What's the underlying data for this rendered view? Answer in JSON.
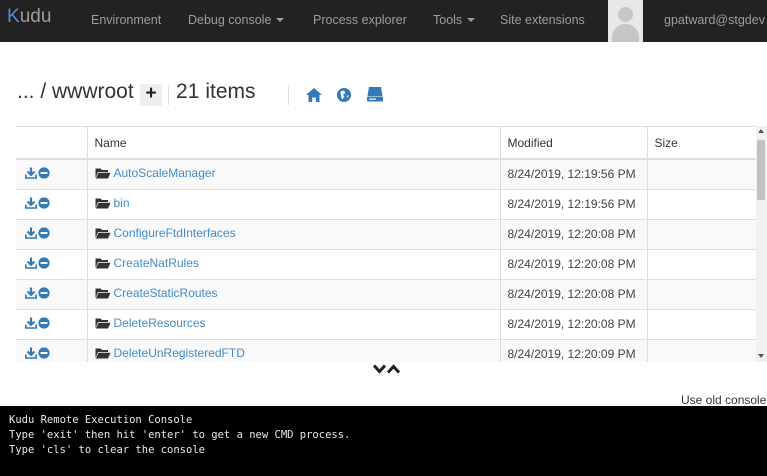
{
  "nav": {
    "brand": "Kudu",
    "items": [
      {
        "label": "Environment",
        "dropdown": false
      },
      {
        "label": "Debug console",
        "dropdown": true
      },
      {
        "label": "Process explorer",
        "dropdown": false
      },
      {
        "label": "Tools",
        "dropdown": true
      },
      {
        "label": "Site extensions",
        "dropdown": false
      }
    ],
    "user": "gpatward@stgdev"
  },
  "breadcrumb": {
    "path": "... / wwwroot",
    "add_label": "+",
    "count": "21",
    "count_label": "items",
    "icons": [
      "home-icon",
      "globe-icon",
      "drive-icon"
    ]
  },
  "table": {
    "columns": [
      "",
      "Name",
      "Modified",
      "Size"
    ],
    "rows": [
      {
        "name": "AutoScaleManager",
        "modified": "8/24/2019, 12:19:56 PM",
        "size": ""
      },
      {
        "name": "bin",
        "modified": "8/24/2019, 12:19:56 PM",
        "size": ""
      },
      {
        "name": "ConfigureFtdInterfaces",
        "modified": "8/24/2019, 12:20:08 PM",
        "size": ""
      },
      {
        "name": "CreateNatRules",
        "modified": "8/24/2019, 12:20:08 PM",
        "size": ""
      },
      {
        "name": "CreateStaticRoutes",
        "modified": "8/24/2019, 12:20:08 PM",
        "size": ""
      },
      {
        "name": "DeleteResources",
        "modified": "8/24/2019, 12:20:08 PM",
        "size": ""
      },
      {
        "name": "DeleteUnRegisteredFTD",
        "modified": "8/24/2019, 12:20:09 PM",
        "size": ""
      }
    ]
  },
  "old_console_link": "Use old console",
  "console": {
    "lines": [
      "Kudu Remote Execution Console",
      "Type 'exit' then hit 'enter' to get a new CMD process.",
      "Type 'cls' to clear the console"
    ]
  },
  "colors": {
    "navbar_bg": "#222222",
    "nav_text": "#9d9d9d",
    "link": "#428bca",
    "console_bg": "#000000"
  }
}
